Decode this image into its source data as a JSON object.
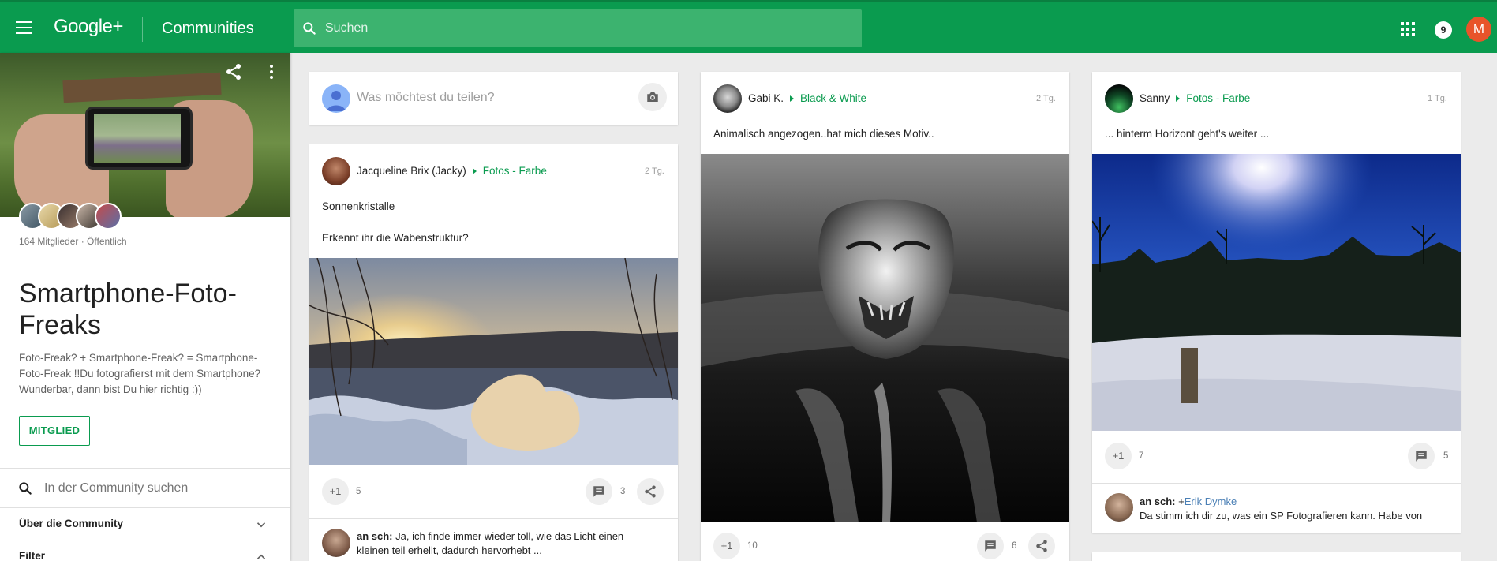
{
  "header": {
    "logo": "Google+",
    "title": "Communities",
    "search_placeholder": "Suchen",
    "notifications": "9",
    "user_initial": "M"
  },
  "community": {
    "member_info": "164 Mitglieder · Öffentlich",
    "title": "Smartphone-Foto-Freaks",
    "description": "Foto-Freak? + Smartphone-Freak? = Smartphone-Foto-Freak !!Du fotografierst mit dem Smartphone? Wunderbar, dann bist Du hier richtig :))",
    "member_button": "MITGLIED",
    "search_placeholder": "In der Community suchen",
    "about_label": "Über die Community",
    "filter_label": "Filter"
  },
  "composer": {
    "placeholder": "Was möchtest du teilen?"
  },
  "posts": [
    {
      "author": "Jacqueline Brix (Jacky)",
      "category": "Fotos - Farbe",
      "time": "2 Tg.",
      "text_line1": "Sonnenkristalle",
      "text_line2": "Erkennt ihr die Wabenstruktur?",
      "plus_label": "+1",
      "plus_count": "5",
      "comment_count": "3",
      "comment_author": "an sch:",
      "comment_text_line1": "Ja, ich finde immer wieder toll, wie das Licht einen",
      "comment_text_line2": "kleinen teil erhellt, dadurch hervorhebt ..."
    },
    {
      "author": "Gabi K.",
      "category": "Black & White",
      "time": "2 Tg.",
      "text_line1": "Animalisch angezogen..hat mich dieses Motiv..",
      "plus_label": "+1",
      "plus_count": "10",
      "comment_count": "6"
    },
    {
      "author": "Sanny",
      "category": "Fotos - Farbe",
      "time": "1 Tg.",
      "text_line1": "... hinterm Horizont geht's weiter ...",
      "plus_label": "+1",
      "plus_count": "7",
      "comment_count": "5",
      "comment_author": "an sch:",
      "comment_mention_prefix": "+",
      "comment_mention": "Erik Dymke",
      "comment_text_line1": "Da stimm ich dir zu, was ein SP Fotografieren kann. Habe von"
    }
  ],
  "colors": {
    "brand_green": "#0a9b4f",
    "search_green": "#3cb36f",
    "avatar_orange": "#e8542a"
  },
  "icons": [
    "menu-icon",
    "search-icon",
    "apps-icon",
    "share-icon",
    "more-vert-icon",
    "camera-icon",
    "comment-icon",
    "chevron-down-icon",
    "chevron-up-icon"
  ]
}
